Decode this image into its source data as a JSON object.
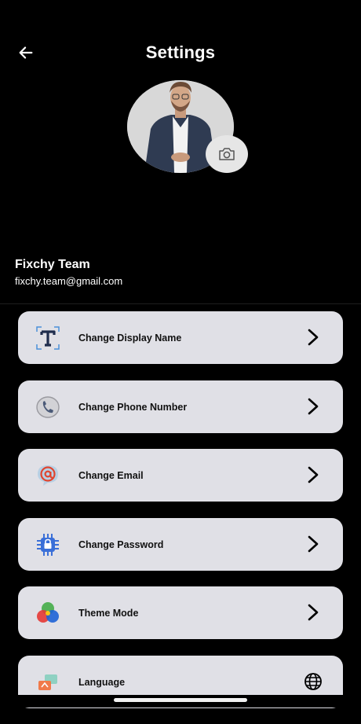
{
  "header": {
    "title": "Settings",
    "back_icon": "arrow-left-icon"
  },
  "profile": {
    "name": "Fixchy Team",
    "email": "fixchy.team@gmail.com",
    "camera_icon": "camera-icon"
  },
  "menu": {
    "items": [
      {
        "label": "Change Display Name",
        "icon": "text-t-icon",
        "trailing_icon": "chevron-right-icon"
      },
      {
        "label": "Change Phone Number",
        "icon": "phone-icon",
        "trailing_icon": "chevron-right-icon"
      },
      {
        "label": "Change Email",
        "icon": "at-sign-icon",
        "trailing_icon": "chevron-right-icon"
      },
      {
        "label": "Change Password",
        "icon": "chip-lock-icon",
        "trailing_icon": "chevron-right-icon"
      },
      {
        "label": "Theme Mode",
        "icon": "color-circles-icon",
        "trailing_icon": "chevron-right-icon"
      },
      {
        "label": "Language",
        "icon": "translate-icon",
        "trailing_icon": "globe-icon"
      }
    ]
  },
  "colors": {
    "background": "#000000",
    "card": "#e0e0e6",
    "text_primary": "#ffffff",
    "card_text": "#111111"
  }
}
